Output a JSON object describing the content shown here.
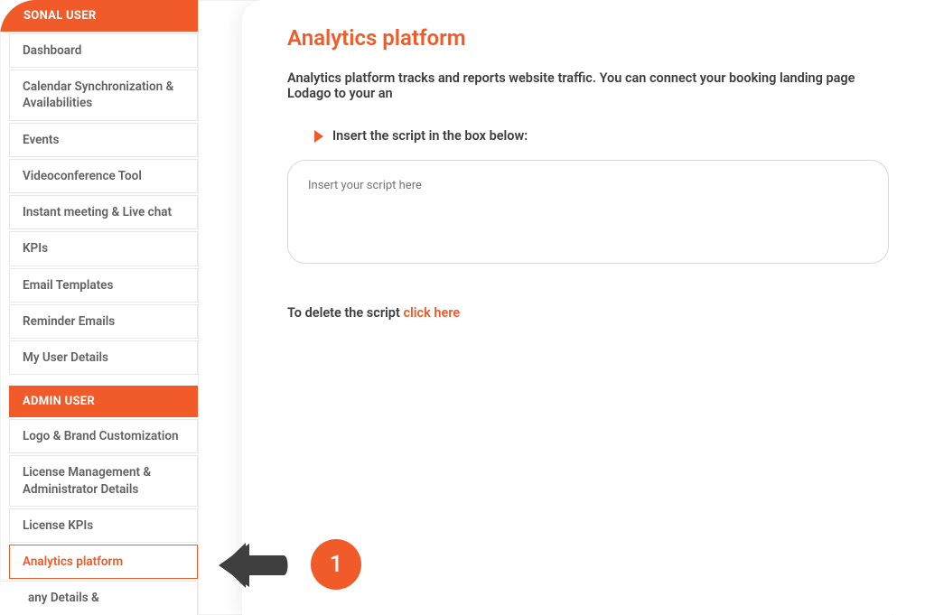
{
  "sidebar": {
    "personal_header": "SONAL USER",
    "admin_header": "ADMIN USER",
    "personal_items": [
      "Dashboard",
      "Calendar Synchronization & Availabilities",
      "Events",
      "Videoconference Tool",
      "Instant meeting & Live chat",
      "KPIs",
      "Email Templates",
      "Reminder Emails",
      "My User Details"
    ],
    "admin_items": [
      "Logo & Brand Customization",
      "License Management & Administrator Details",
      "License KPIs",
      "Analytics platform",
      "any Details &"
    ],
    "active_admin_index": 3
  },
  "page": {
    "title": "Analytics platform",
    "description": "Analytics platform tracks and reports website traffic. You can connect your booking landing page Lodago to your an",
    "instruction": "Insert the script in the box below:",
    "script_placeholder": "Insert your script here",
    "delete_prefix": "To delete the script ",
    "delete_link": "click here"
  },
  "annotation": {
    "step": "1"
  },
  "colors": {
    "accent": "#f15a29"
  }
}
